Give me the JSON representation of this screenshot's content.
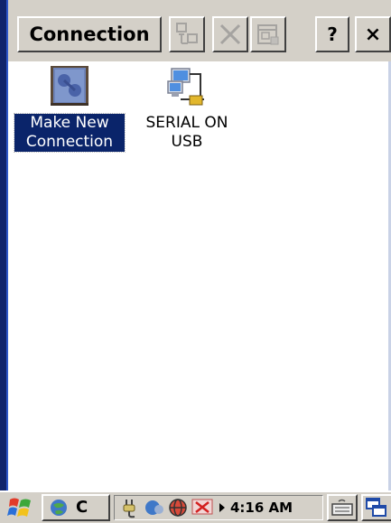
{
  "toolbar": {
    "title_button_label": "Connection",
    "help_label": "?",
    "close_label": "×"
  },
  "items": [
    {
      "label_line1": "Make New",
      "label_line2": "Connection",
      "selected": true,
      "icon": "make-new-connection-icon"
    },
    {
      "label_line1": "SERIAL ON",
      "label_line2": "USB",
      "selected": false,
      "icon": "serial-connection-icon"
    }
  ],
  "taskbar": {
    "start_icon": "windows-flag-icon",
    "app_button_label": "C",
    "clock": "4:16 AM"
  }
}
